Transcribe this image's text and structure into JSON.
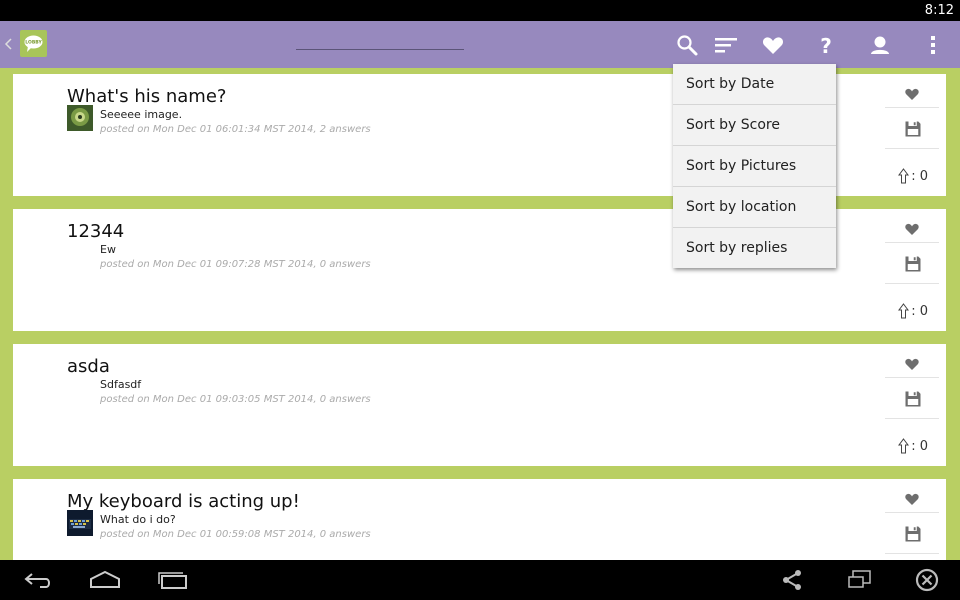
{
  "status_bar": {
    "time": "8:12"
  },
  "action_bar": {
    "logo_text": "LOBBY",
    "actions": [
      "search-icon",
      "sort-icon",
      "favorite-icon",
      "help-icon",
      "profile-icon",
      "overflow-icon"
    ]
  },
  "sort_menu": {
    "items": [
      "Sort by Date",
      "Sort by Score",
      "Sort by Pictures",
      "Sort by location",
      "Sort by replies"
    ]
  },
  "questions": [
    {
      "title": "What's his name?",
      "body": "Seeeee image.",
      "meta": "posted on Mon Dec 01 06:01:34 MST 2014, 2 answers",
      "votes": ": 0",
      "has_thumb": true
    },
    {
      "title": "12344",
      "body": "Ew",
      "meta": "posted on Mon Dec 01 09:07:28 MST 2014, 0 answers",
      "votes": ": 0",
      "has_thumb": false
    },
    {
      "title": "asda",
      "body": "Sdfasdf",
      "meta": "posted on Mon Dec 01 09:03:05 MST 2014, 0 answers",
      "votes": ": 0",
      "has_thumb": false
    },
    {
      "title": "My keyboard is acting up!",
      "body": "What do i do?",
      "meta": "posted on Mon Dec 01 00:59:08 MST 2014, 0 answers",
      "votes": ": 0",
      "has_thumb": true
    }
  ],
  "colors": {
    "action_bar": "#9789be",
    "background": "#b9cf63",
    "card": "#ffffff"
  },
  "nav_bar": {
    "icons": [
      "back-icon",
      "home-icon",
      "recents-icon",
      "share-icon",
      "screen-icon",
      "close-icon"
    ]
  }
}
